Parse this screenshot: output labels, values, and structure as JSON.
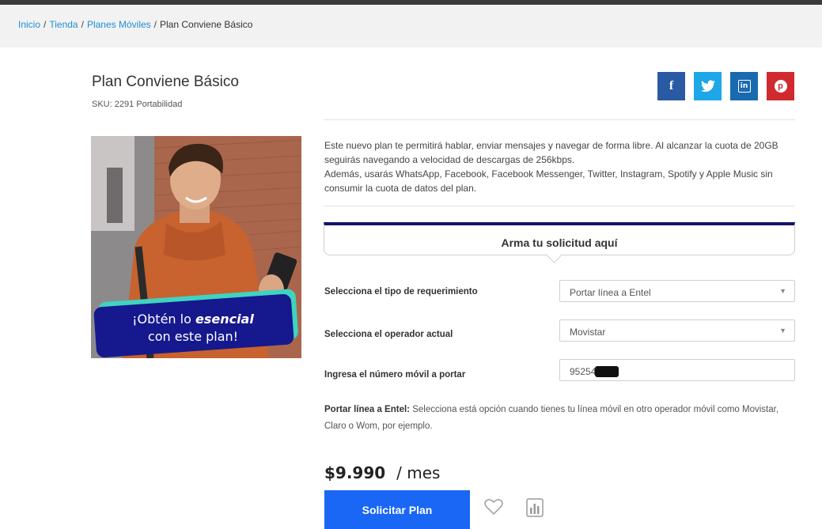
{
  "breadcrumb": {
    "items": [
      "Inicio",
      "Tienda",
      "Planes Móviles"
    ],
    "separator": "/",
    "current": "Plan Conviene Básico"
  },
  "product": {
    "title": "Plan Conviene Básico",
    "sku": "SKU: 2291 Portabilidad",
    "description_lines": [
      "Este nuevo plan te permitirá hablar, enviar mensajes y navegar de forma libre. Al alcanzar la cuota de 20GB seguirás navegando a velocidad de descargas de 256kbps.",
      "Además, usarás WhatsApp, Facebook, Facebook Messenger, Twitter, Instagram, Spotify y Apple Music sin consumir la cuota de datos del plan."
    ],
    "image_banner": {
      "line1_prefix": "¡Obtén lo ",
      "line1_emphasis": "esencial",
      "line2": "con este plan!"
    }
  },
  "share": {
    "icons": [
      "facebook-icon",
      "twitter-icon",
      "linkedin-icon",
      "pinterest-icon"
    ],
    "colors": {
      "facebook": "#2a5aa3",
      "twitter": "#1da6e8",
      "linkedin": "#1a6ab0",
      "pinterest": "#d02a2f"
    }
  },
  "form": {
    "title": "Arma tu solicitud aquí",
    "requirement_label": "Selecciona el tipo de requerimiento",
    "requirement_value": "Portar línea a Entel",
    "operator_label": "Selecciona el operador actual",
    "operator_value": "Movistar",
    "number_label": "Ingresa el número móvil a portar",
    "number_value": "95254",
    "note_bold": "Portar línea a Entel:",
    "note_text": " Selecciona está opción cuando tienes tu línea móvil en otro operador móvil como Movistar, Claro o Wom, por ejemplo."
  },
  "pricing": {
    "amount": "$9.990",
    "period": "/ mes"
  },
  "actions": {
    "cta_label": "Solicitar Plan",
    "accent_color": "#1967f4"
  }
}
